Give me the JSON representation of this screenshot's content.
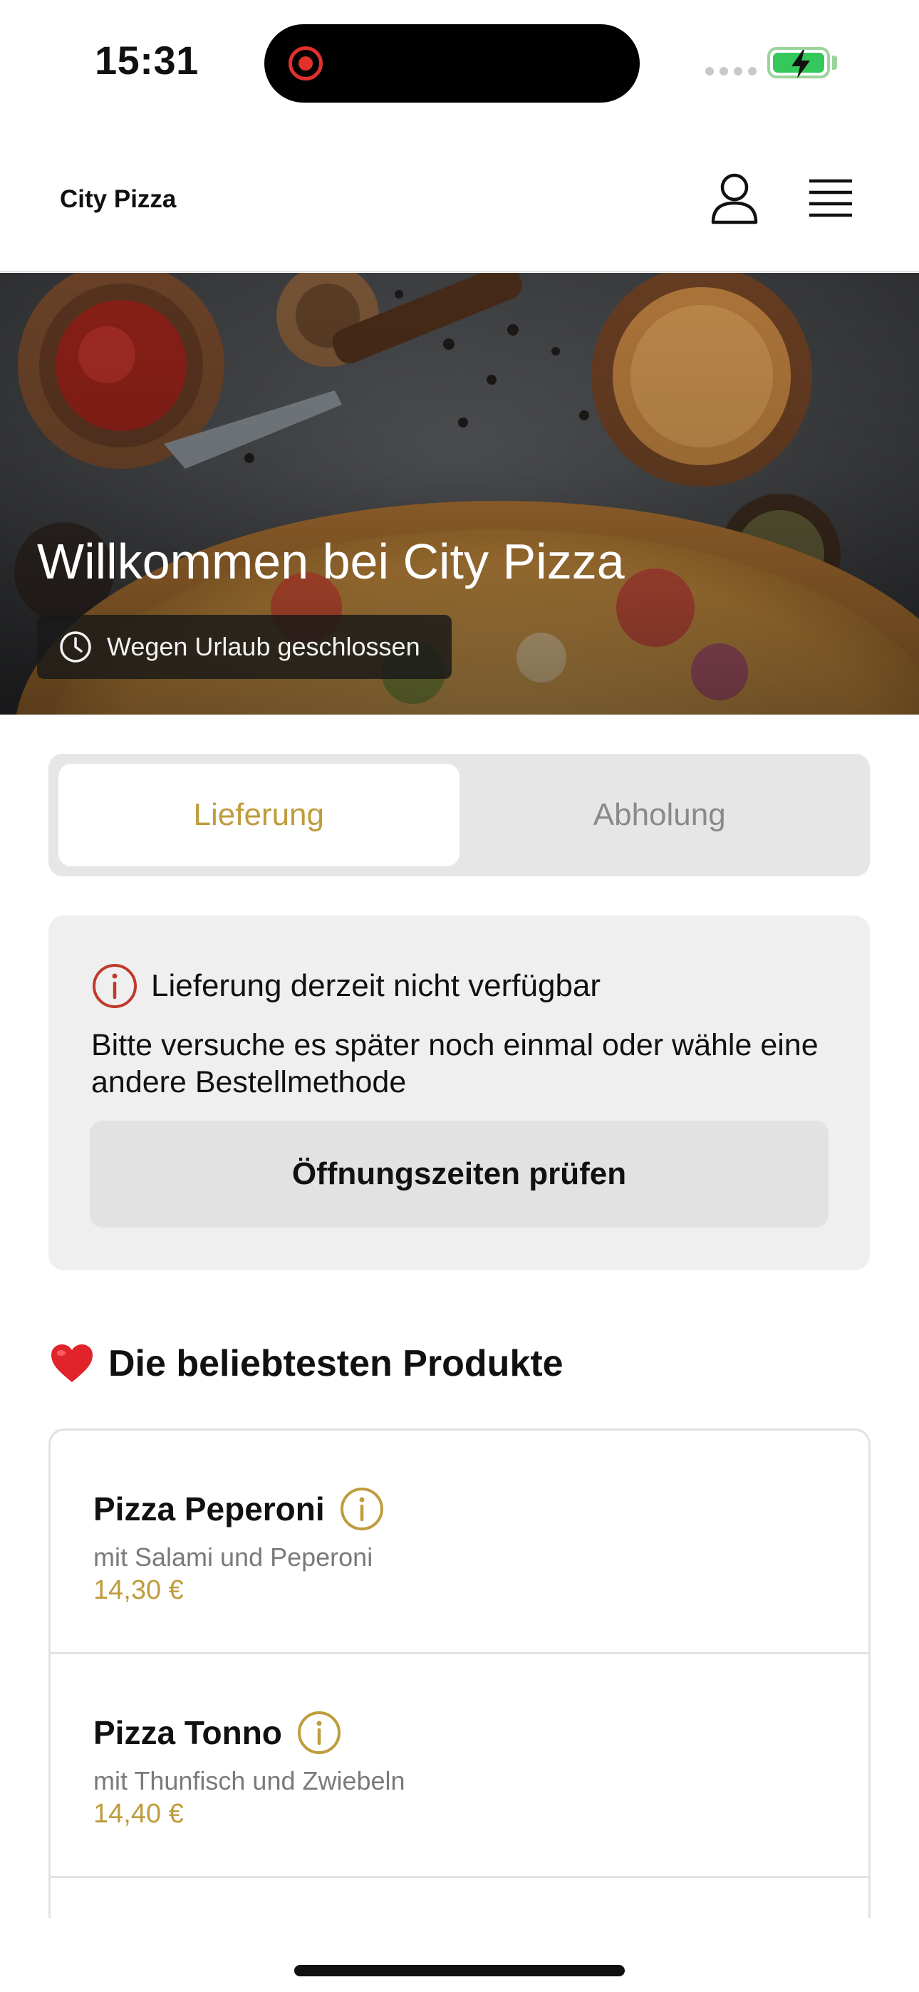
{
  "status_bar": {
    "time": "15:31",
    "battery_color": "#34c759",
    "recording_color": "#e2302a"
  },
  "header": {
    "brand": "City Pizza",
    "icons": [
      "user-icon",
      "menu-icon"
    ]
  },
  "hero": {
    "title": "Willkommen bei City Pizza",
    "badge_text": "Wegen Urlaub geschlossen",
    "badge_icon": "clock-icon"
  },
  "order_mode": {
    "options": [
      {
        "label": "Lieferung",
        "selected": true
      },
      {
        "label": "Abholung",
        "selected": false
      }
    ]
  },
  "notice": {
    "icon": "info-icon",
    "title": "Lieferung derzeit nicht verfügbar",
    "body": "Bitte versuche es später noch einmal oder wähle eine andere Bestellmethode",
    "button_label": "Öffnungszeiten prüfen"
  },
  "popular": {
    "emoji": "❤️",
    "title": "Die beliebtesten Produkte",
    "items": [
      {
        "name": "Pizza Peperoni",
        "description": "mit Salami und Peperoni",
        "price": "14,30 €"
      },
      {
        "name": "Pizza Tonno",
        "description": "mit Thunfisch und Zwiebeln",
        "price": "14,40 €"
      }
    ]
  },
  "colors": {
    "accent": "#bf9c3c",
    "alert": "#c0392b"
  }
}
